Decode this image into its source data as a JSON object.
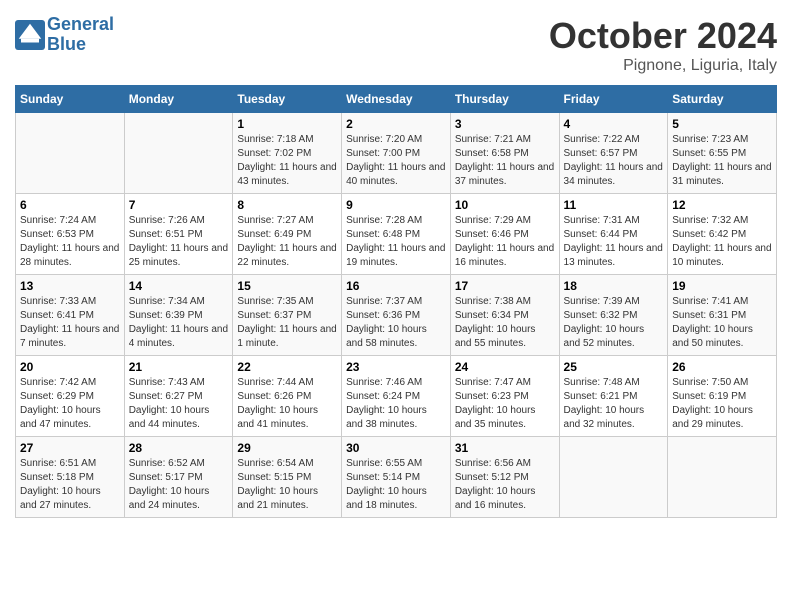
{
  "header": {
    "logo_line1": "General",
    "logo_line2": "Blue",
    "month": "October 2024",
    "location": "Pignone, Liguria, Italy"
  },
  "weekdays": [
    "Sunday",
    "Monday",
    "Tuesday",
    "Wednesday",
    "Thursday",
    "Friday",
    "Saturday"
  ],
  "weeks": [
    [
      null,
      null,
      {
        "day": "1",
        "sunrise": "7:18 AM",
        "sunset": "7:02 PM",
        "daylight": "11 hours and 43 minutes."
      },
      {
        "day": "2",
        "sunrise": "7:20 AM",
        "sunset": "7:00 PM",
        "daylight": "11 hours and 40 minutes."
      },
      {
        "day": "3",
        "sunrise": "7:21 AM",
        "sunset": "6:58 PM",
        "daylight": "11 hours and 37 minutes."
      },
      {
        "day": "4",
        "sunrise": "7:22 AM",
        "sunset": "6:57 PM",
        "daylight": "11 hours and 34 minutes."
      },
      {
        "day": "5",
        "sunrise": "7:23 AM",
        "sunset": "6:55 PM",
        "daylight": "11 hours and 31 minutes."
      }
    ],
    [
      {
        "day": "6",
        "sunrise": "7:24 AM",
        "sunset": "6:53 PM",
        "daylight": "11 hours and 28 minutes."
      },
      {
        "day": "7",
        "sunrise": "7:26 AM",
        "sunset": "6:51 PM",
        "daylight": "11 hours and 25 minutes."
      },
      {
        "day": "8",
        "sunrise": "7:27 AM",
        "sunset": "6:49 PM",
        "daylight": "11 hours and 22 minutes."
      },
      {
        "day": "9",
        "sunrise": "7:28 AM",
        "sunset": "6:48 PM",
        "daylight": "11 hours and 19 minutes."
      },
      {
        "day": "10",
        "sunrise": "7:29 AM",
        "sunset": "6:46 PM",
        "daylight": "11 hours and 16 minutes."
      },
      {
        "day": "11",
        "sunrise": "7:31 AM",
        "sunset": "6:44 PM",
        "daylight": "11 hours and 13 minutes."
      },
      {
        "day": "12",
        "sunrise": "7:32 AM",
        "sunset": "6:42 PM",
        "daylight": "11 hours and 10 minutes."
      }
    ],
    [
      {
        "day": "13",
        "sunrise": "7:33 AM",
        "sunset": "6:41 PM",
        "daylight": "11 hours and 7 minutes."
      },
      {
        "day": "14",
        "sunrise": "7:34 AM",
        "sunset": "6:39 PM",
        "daylight": "11 hours and 4 minutes."
      },
      {
        "day": "15",
        "sunrise": "7:35 AM",
        "sunset": "6:37 PM",
        "daylight": "11 hours and 1 minute."
      },
      {
        "day": "16",
        "sunrise": "7:37 AM",
        "sunset": "6:36 PM",
        "daylight": "10 hours and 58 minutes."
      },
      {
        "day": "17",
        "sunrise": "7:38 AM",
        "sunset": "6:34 PM",
        "daylight": "10 hours and 55 minutes."
      },
      {
        "day": "18",
        "sunrise": "7:39 AM",
        "sunset": "6:32 PM",
        "daylight": "10 hours and 52 minutes."
      },
      {
        "day": "19",
        "sunrise": "7:41 AM",
        "sunset": "6:31 PM",
        "daylight": "10 hours and 50 minutes."
      }
    ],
    [
      {
        "day": "20",
        "sunrise": "7:42 AM",
        "sunset": "6:29 PM",
        "daylight": "10 hours and 47 minutes."
      },
      {
        "day": "21",
        "sunrise": "7:43 AM",
        "sunset": "6:27 PM",
        "daylight": "10 hours and 44 minutes."
      },
      {
        "day": "22",
        "sunrise": "7:44 AM",
        "sunset": "6:26 PM",
        "daylight": "10 hours and 41 minutes."
      },
      {
        "day": "23",
        "sunrise": "7:46 AM",
        "sunset": "6:24 PM",
        "daylight": "10 hours and 38 minutes."
      },
      {
        "day": "24",
        "sunrise": "7:47 AM",
        "sunset": "6:23 PM",
        "daylight": "10 hours and 35 minutes."
      },
      {
        "day": "25",
        "sunrise": "7:48 AM",
        "sunset": "6:21 PM",
        "daylight": "10 hours and 32 minutes."
      },
      {
        "day": "26",
        "sunrise": "7:50 AM",
        "sunset": "6:19 PM",
        "daylight": "10 hours and 29 minutes."
      }
    ],
    [
      {
        "day": "27",
        "sunrise": "6:51 AM",
        "sunset": "5:18 PM",
        "daylight": "10 hours and 27 minutes."
      },
      {
        "day": "28",
        "sunrise": "6:52 AM",
        "sunset": "5:17 PM",
        "daylight": "10 hours and 24 minutes."
      },
      {
        "day": "29",
        "sunrise": "6:54 AM",
        "sunset": "5:15 PM",
        "daylight": "10 hours and 21 minutes."
      },
      {
        "day": "30",
        "sunrise": "6:55 AM",
        "sunset": "5:14 PM",
        "daylight": "10 hours and 18 minutes."
      },
      {
        "day": "31",
        "sunrise": "6:56 AM",
        "sunset": "5:12 PM",
        "daylight": "10 hours and 16 minutes."
      },
      null,
      null
    ]
  ]
}
